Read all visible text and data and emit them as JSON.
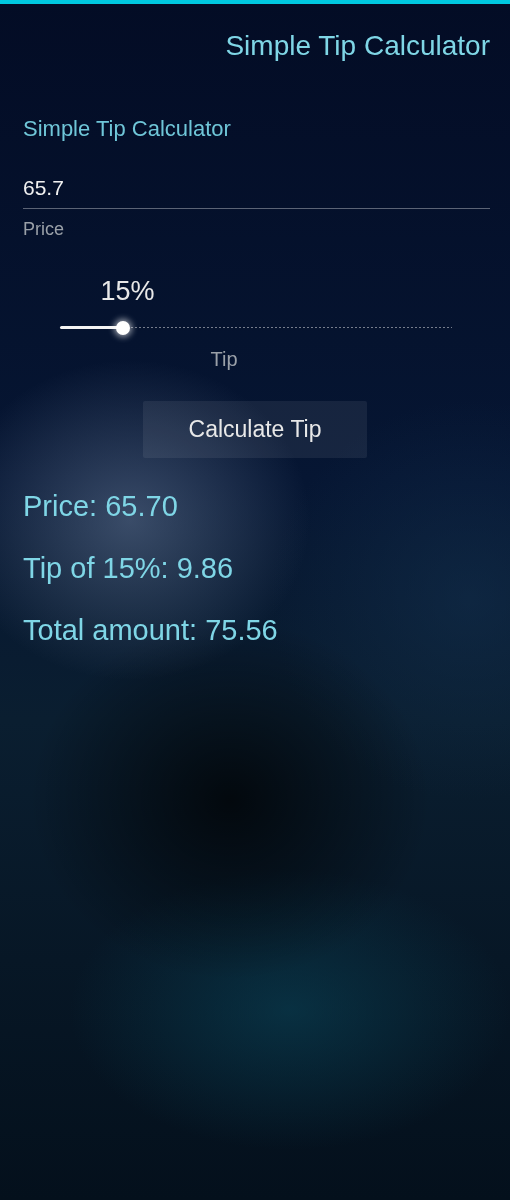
{
  "page_header": {
    "title": "Simple Tip Calculator"
  },
  "section_header": "Simple Tip Calculator",
  "price_field": {
    "value": "65.7",
    "label": "Price"
  },
  "tip_slider": {
    "value_text": "15%",
    "level": 0.16,
    "label": "Tip"
  },
  "button": "Calculate Tip",
  "results": [
    "Price: 65.70",
    "Tip of 15%: 9.86",
    "Total amount: 75.56"
  ]
}
